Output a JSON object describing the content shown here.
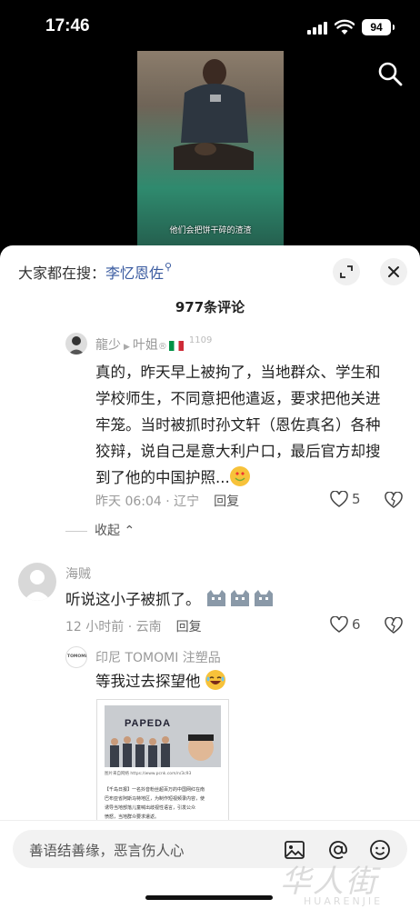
{
  "status_bar": {
    "time": "17:46",
    "battery": "94"
  },
  "video": {
    "subtitle": "他们会把饼干碎的渣渣"
  },
  "sheet": {
    "search_prefix": "大家都在搜：",
    "search_keyword": "李忆恩佐",
    "comment_count": "977条评论"
  },
  "comments": [
    {
      "user": "龍少",
      "reply_to": "叶姐",
      "reply_to_badge": "1109",
      "text_lines": [
        "真的，昨天早上被拘了，当地群众、学生和",
        "学校师生，不同意把他遣返，要求把他关进",
        "牢笼。当时被抓时孙文轩（恩佐真名）各种",
        "狡辩，说自己是意大利户口，最后官方却搜",
        "到了他的中国护照..."
      ],
      "time_loc": "昨天 06:04 · 辽宁",
      "reply_label": "回复",
      "likes": "5",
      "collapse_label": "收起"
    },
    {
      "user": "海贼",
      "text": "听说这小子被抓了。",
      "time_loc": "12 小时前 · 云南",
      "reply_label": "回复",
      "likes": "6"
    },
    {
      "user": "印尼 TOMOMI 注塑品",
      "avatar_text": "TOMOMI",
      "text": "等我过去探望他"
    }
  ],
  "article_preview": {
    "sign": "PAPEDA",
    "caption": "图片来自网络 https://www.pcnk.com/n/3c93",
    "lines": [
      "【千岛日报】一名抖音粉丝超百万的中国网红在南",
      "巴布亚省阿斯马特地区，为制作短视频录内容，使",
      "诱导当地部落儿童喊出歧视性语言，引发公众",
      "愤怒，当地群众要求遣返。"
    ]
  },
  "bottom_bar": {
    "input_placeholder": "善语结善缘，恶言伤人心"
  },
  "watermark": {
    "cn": "华人街",
    "en": "HUARENJIE"
  },
  "colors": {
    "keyword": "#3a5ba0",
    "sheet_bg": "#ffffff",
    "screen_bg": "#000000"
  },
  "icons": [
    "signal-icon",
    "wifi-icon",
    "search-icon",
    "expand-icon",
    "close-icon",
    "heart-icon",
    "broken-heart-icon",
    "image-icon",
    "at-icon",
    "emoji-icon",
    "cat-face-icon"
  ]
}
